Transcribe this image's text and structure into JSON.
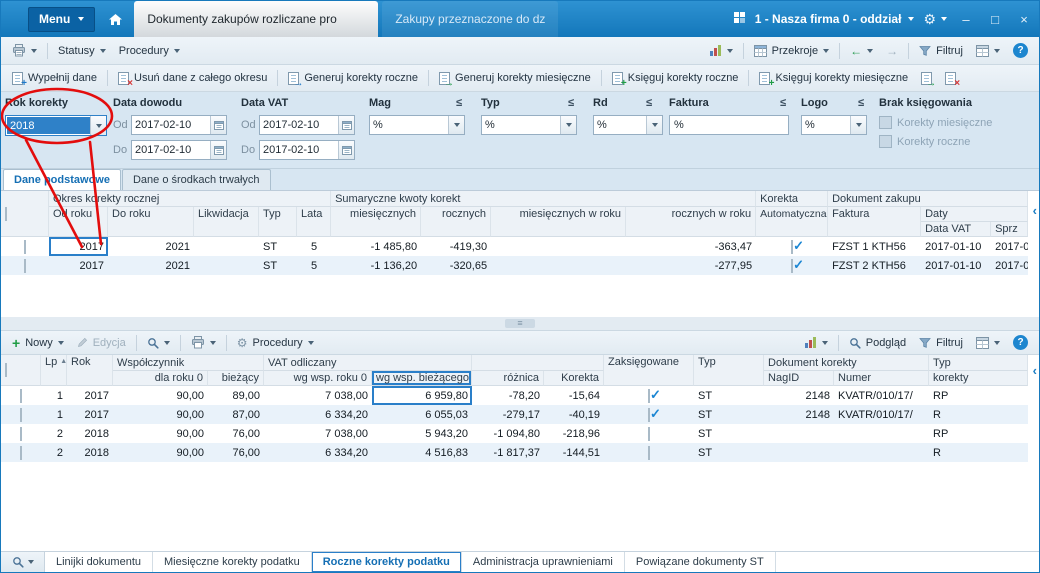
{
  "icons": {
    "gear": "⚙",
    "help": "?",
    "minimize": "–",
    "maximize": "□",
    "close": "×",
    "sort_asc": "▲",
    "collapse": "‹",
    "arrow_left": "←",
    "arrow_right": "→",
    "plus": "+",
    "cross": "×",
    "grip": "≡"
  },
  "colors": {
    "accent": "#1d7fc4",
    "negative": "#e02f2f",
    "annotation_red": "#e30d0d",
    "titlebar_blue": "#1478bb"
  },
  "titlebar": {
    "menu": "Menu",
    "doc_tabs": [
      {
        "label": "Dokumenty zakupów rozliczane pro",
        "active": true
      },
      {
        "label": "Zakupy przeznaczone do dz",
        "active": false
      }
    ],
    "company": "1 - Nasza firma 0 - oddział"
  },
  "toolbar_top": {
    "statusy": "Statusy",
    "procedury": "Procedury",
    "przekroje": "Przekroje",
    "filtruj": "Filtruj"
  },
  "actions": {
    "wypelnij": "Wypełnij dane",
    "usun": "Usuń dane z całego okresu",
    "gen_roczne": "Generuj korekty roczne",
    "gen_miesieczne": "Generuj korekty miesięczne",
    "ksieguj_roczne": "Księguj korekty roczne",
    "ksieguj_miesieczne": "Księguj korekty miesięczne"
  },
  "filters": {
    "op": "≤",
    "rok_korekty": {
      "label": "Rok korekty",
      "value": "2018"
    },
    "data_dowodu": {
      "label": "Data dowodu",
      "od_label": "Od",
      "do_label": "Do",
      "od": "2017-02-10",
      "do": "2017-02-10"
    },
    "data_vat": {
      "label": "Data VAT",
      "od_label": "Od",
      "do_label": "Do",
      "od": "2017-02-10",
      "do": "2017-02-10"
    },
    "mag": {
      "label": "Mag",
      "value": "%"
    },
    "typ": {
      "label": "Typ",
      "value": "%"
    },
    "rd": {
      "label": "Rd",
      "value": "%"
    },
    "faktura": {
      "label": "Faktura",
      "value": "%"
    },
    "logo": {
      "label": "Logo",
      "value": "%"
    },
    "brak_ksiegowania": {
      "label": "Brak księgowania",
      "cb_miesieczne": "Korekty miesięczne",
      "cb_roczne": "Korekty roczne"
    }
  },
  "view_tabs": [
    {
      "label": "Dane podstawowe",
      "active": true
    },
    {
      "label": "Dane o środkach trwałych",
      "active": false
    }
  ],
  "upper_grid": {
    "groups": {
      "okres": "Okres korekty rocznej",
      "sumy": "Sumaryczne kwoty korekt",
      "korekta": "Korekta",
      "dokument": "Dokument zakupu",
      "daty": "Daty"
    },
    "cols": {
      "od_roku": "Od roku",
      "do_roku": "Do roku",
      "likwidacja": "Likwidacja",
      "typ": "Typ",
      "lata": "Lata",
      "miesiecznych": "miesięcznych",
      "rocznych": "rocznych",
      "mies_w_roku": "miesięcznych w roku",
      "rocz_w_roku": "rocznych w roku",
      "automatyczna": "Automatyczna",
      "faktura": "Faktura",
      "data_vat": "Data VAT",
      "sprz": "Sprz"
    },
    "rows": [
      {
        "od_roku": "2017",
        "do_roku": "2021",
        "likwidacja": "",
        "typ": "ST",
        "lata": "5",
        "miesiecznych": "-1 485,80",
        "rocznych": "-419,30",
        "mies_w_roku": "",
        "rocz_w_roku": "-363,47",
        "automatyczna": true,
        "faktura": "FZST 1 KTH56",
        "data_vat": "2017-01-10",
        "sprz": "2017-0"
      },
      {
        "od_roku": "2017",
        "do_roku": "2021",
        "likwidacja": "",
        "typ": "ST",
        "lata": "5",
        "miesiecznych": "-1 136,20",
        "rocznych": "-320,65",
        "mies_w_roku": "",
        "rocz_w_roku": "-277,95",
        "automatyczna": true,
        "faktura": "FZST 2 KTH56",
        "data_vat": "2017-01-10",
        "sprz": "2017-0"
      }
    ]
  },
  "toolbar_lower": {
    "nowy": "Nowy",
    "edycja": "Edycja",
    "procedury": "Procedury",
    "podglad": "Podgląd",
    "filtruj": "Filtruj"
  },
  "lower_grid": {
    "groups": {
      "wspolczynnik": "Współczynnik",
      "vat_odliczany": "VAT odliczany",
      "dokument_korekty": "Dokument korekty"
    },
    "cols": {
      "lp": "Lp",
      "rok": "Rok",
      "dla_roku_0": "dla roku 0",
      "biezacy": "bieżący",
      "wg_wsp_roku_0": "wg wsp. roku 0",
      "wg_wsp_biezacego": "wg wsp. bieżącego",
      "roznica": "różnica",
      "korekta": "Korekta",
      "zaksiegowane": "Zaksięgowane",
      "typ": "Typ",
      "nagid": "NagID",
      "numer": "Numer",
      "typ_korekty_l1": "Typ",
      "typ_korekty_l2": "korekty"
    },
    "rows": [
      {
        "lp": "1",
        "rok": "2017",
        "dla_roku_0": "90,00",
        "biezacy": "89,00",
        "wg_wsp_roku_0": "7 038,00",
        "wg_wsp_biezacego": "6 959,80",
        "roznica": "-78,20",
        "korekta": "-15,64",
        "zaksiegowane": true,
        "typ": "ST",
        "nagid": "2148",
        "numer": "KVATR/010/17/",
        "typ_korekty": "RP"
      },
      {
        "lp": "1",
        "rok": "2017",
        "dla_roku_0": "90,00",
        "biezacy": "87,00",
        "wg_wsp_roku_0": "6 334,20",
        "wg_wsp_biezacego": "6 055,03",
        "roznica": "-279,17",
        "korekta": "-40,19",
        "zaksiegowane": true,
        "typ": "ST",
        "nagid": "2148",
        "numer": "KVATR/010/17/",
        "typ_korekty": "R"
      },
      {
        "lp": "2",
        "rok": "2018",
        "dla_roku_0": "90,00",
        "biezacy": "76,00",
        "wg_wsp_roku_0": "7 038,00",
        "wg_wsp_biezacego": "5 943,20",
        "roznica": "-1 094,80",
        "korekta": "-218,96",
        "zaksiegowane": false,
        "typ": "ST",
        "nagid": "",
        "numer": "",
        "typ_korekty": "RP"
      },
      {
        "lp": "2",
        "rok": "2018",
        "dla_roku_0": "90,00",
        "biezacy": "76,00",
        "wg_wsp_roku_0": "6 334,20",
        "wg_wsp_biezacego": "4 516,83",
        "roznica": "-1 817,37",
        "korekta": "-144,51",
        "zaksiegowane": false,
        "typ": "ST",
        "nagid": "",
        "numer": "",
        "typ_korekty": "R"
      }
    ]
  },
  "bottom_tabs": [
    {
      "label": "Linijki dokumentu",
      "active": false
    },
    {
      "label": "Miesięczne korekty podatku",
      "active": false
    },
    {
      "label": "Roczne korekty podatku",
      "active": true
    },
    {
      "label": "Administracja uprawnieniami",
      "active": false
    },
    {
      "label": "Powiązane dokumenty ST",
      "active": false
    }
  ]
}
